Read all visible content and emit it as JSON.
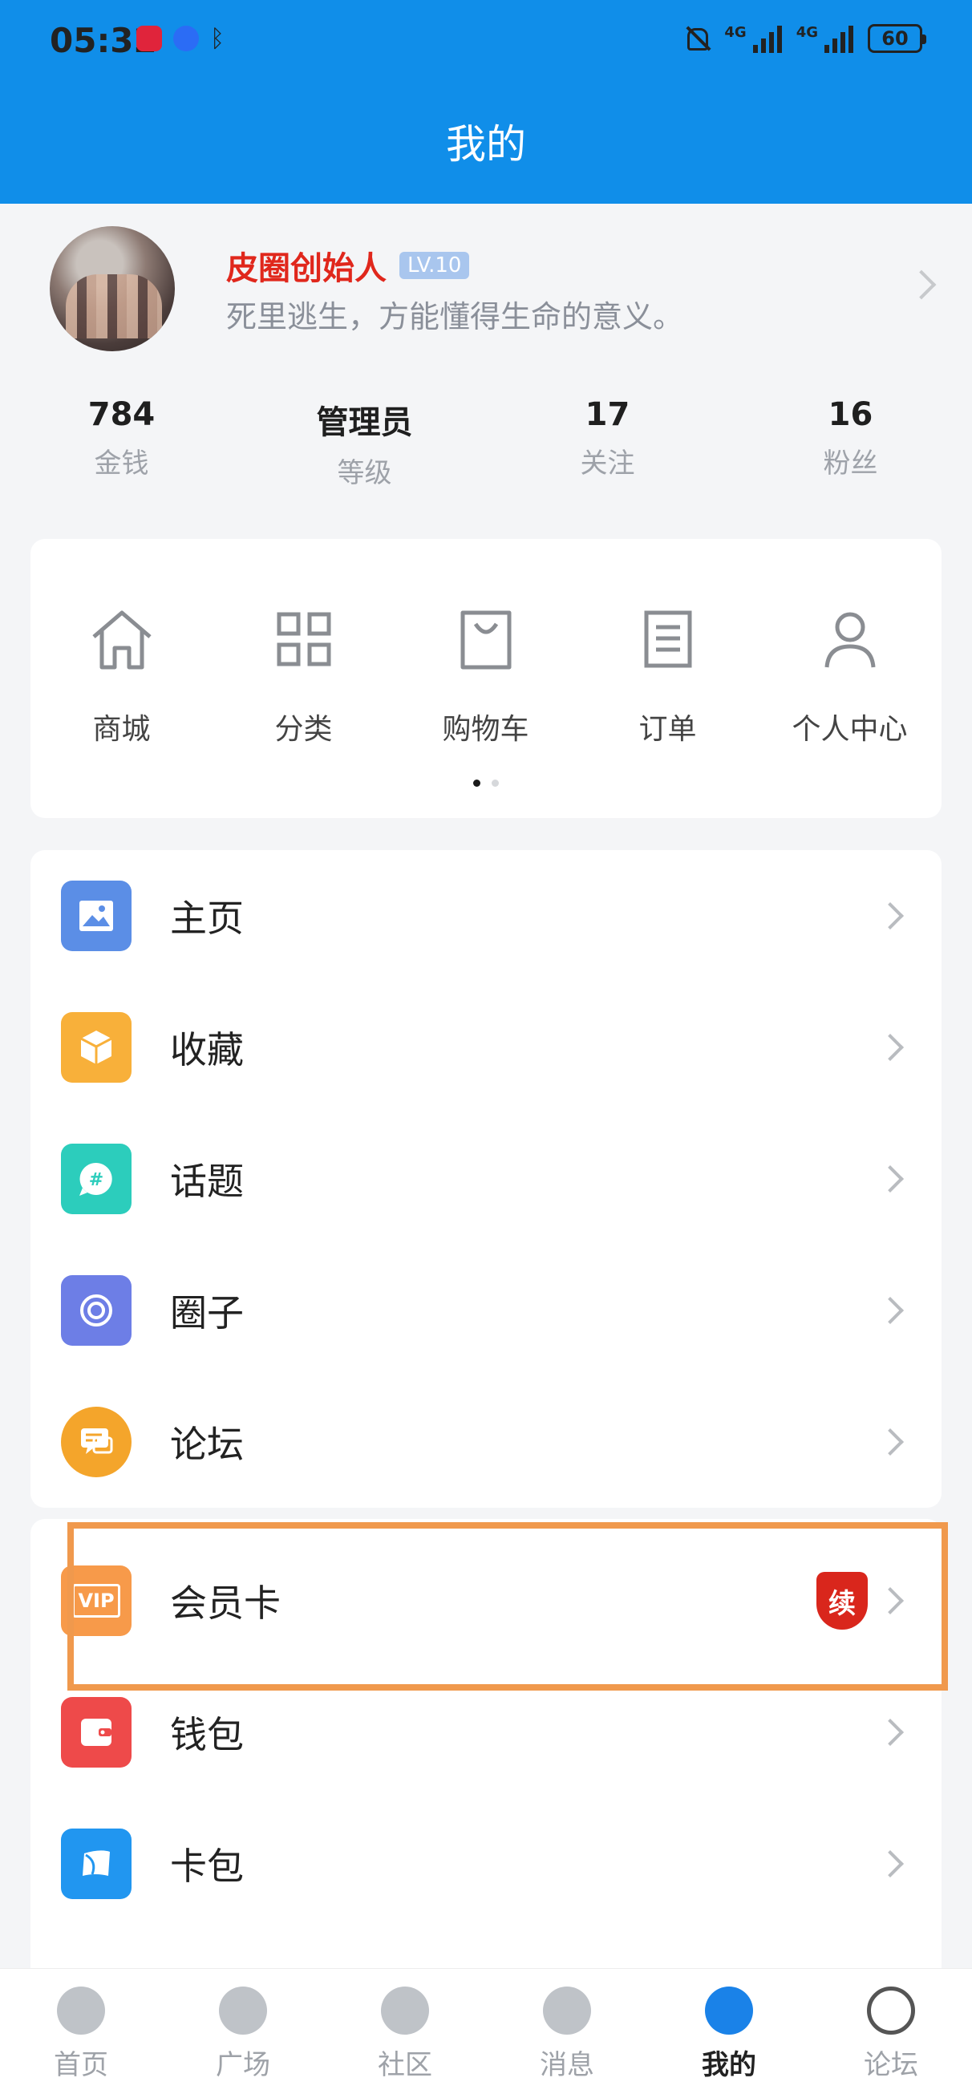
{
  "status": {
    "time": "05:32",
    "battery": "60",
    "network": "4G"
  },
  "header": {
    "title": "我的"
  },
  "profile": {
    "nickname": "皮圈创始人",
    "level": "LV.10",
    "signature": "死里逃生，方能懂得生命的意义。",
    "stats": [
      {
        "value": "784",
        "label": "金钱"
      },
      {
        "value": "管理员",
        "label": "等级"
      },
      {
        "value": "17",
        "label": "关注"
      },
      {
        "value": "16",
        "label": "粉丝"
      }
    ]
  },
  "quick_menu": [
    {
      "label": "商城",
      "icon": "home-icon"
    },
    {
      "label": "分类",
      "icon": "grid-icon"
    },
    {
      "label": "购物车",
      "icon": "shopping-bag-icon"
    },
    {
      "label": "订单",
      "icon": "document-icon"
    },
    {
      "label": "个人中心",
      "icon": "user-icon"
    }
  ],
  "menu_list_1": [
    {
      "label": "主页",
      "icon": "image-icon",
      "color": "#5b8ee6"
    },
    {
      "label": "收藏",
      "icon": "box-icon",
      "color": "#f8b03a"
    },
    {
      "label": "话题",
      "icon": "hashtag-icon",
      "color": "#2ccdbc"
    },
    {
      "label": "圈子",
      "icon": "circle-icon",
      "color": "#6d7ee6"
    },
    {
      "label": "论坛",
      "icon": "chat-icon",
      "color": "#f4a52b"
    }
  ],
  "menu_list_2": [
    {
      "label": "会员卡",
      "icon": "vip-card-icon",
      "color": "#f79a4a",
      "badge": "续"
    },
    {
      "label": "钱包",
      "icon": "wallet-icon",
      "color": "#ee4a4a"
    },
    {
      "label": "卡包",
      "icon": "card-icon",
      "color": "#2196f0"
    }
  ],
  "vip_icon_text": "VIP",
  "tabs": [
    {
      "label": "首页",
      "icon": "home-tab-icon"
    },
    {
      "label": "广场",
      "icon": "compass-icon"
    },
    {
      "label": "社区",
      "icon": "aperture-icon"
    },
    {
      "label": "消息",
      "icon": "message-icon"
    },
    {
      "label": "我的",
      "icon": "profile-tab-icon",
      "active": true
    },
    {
      "label": "论坛",
      "icon": "forum-tab-icon"
    }
  ]
}
